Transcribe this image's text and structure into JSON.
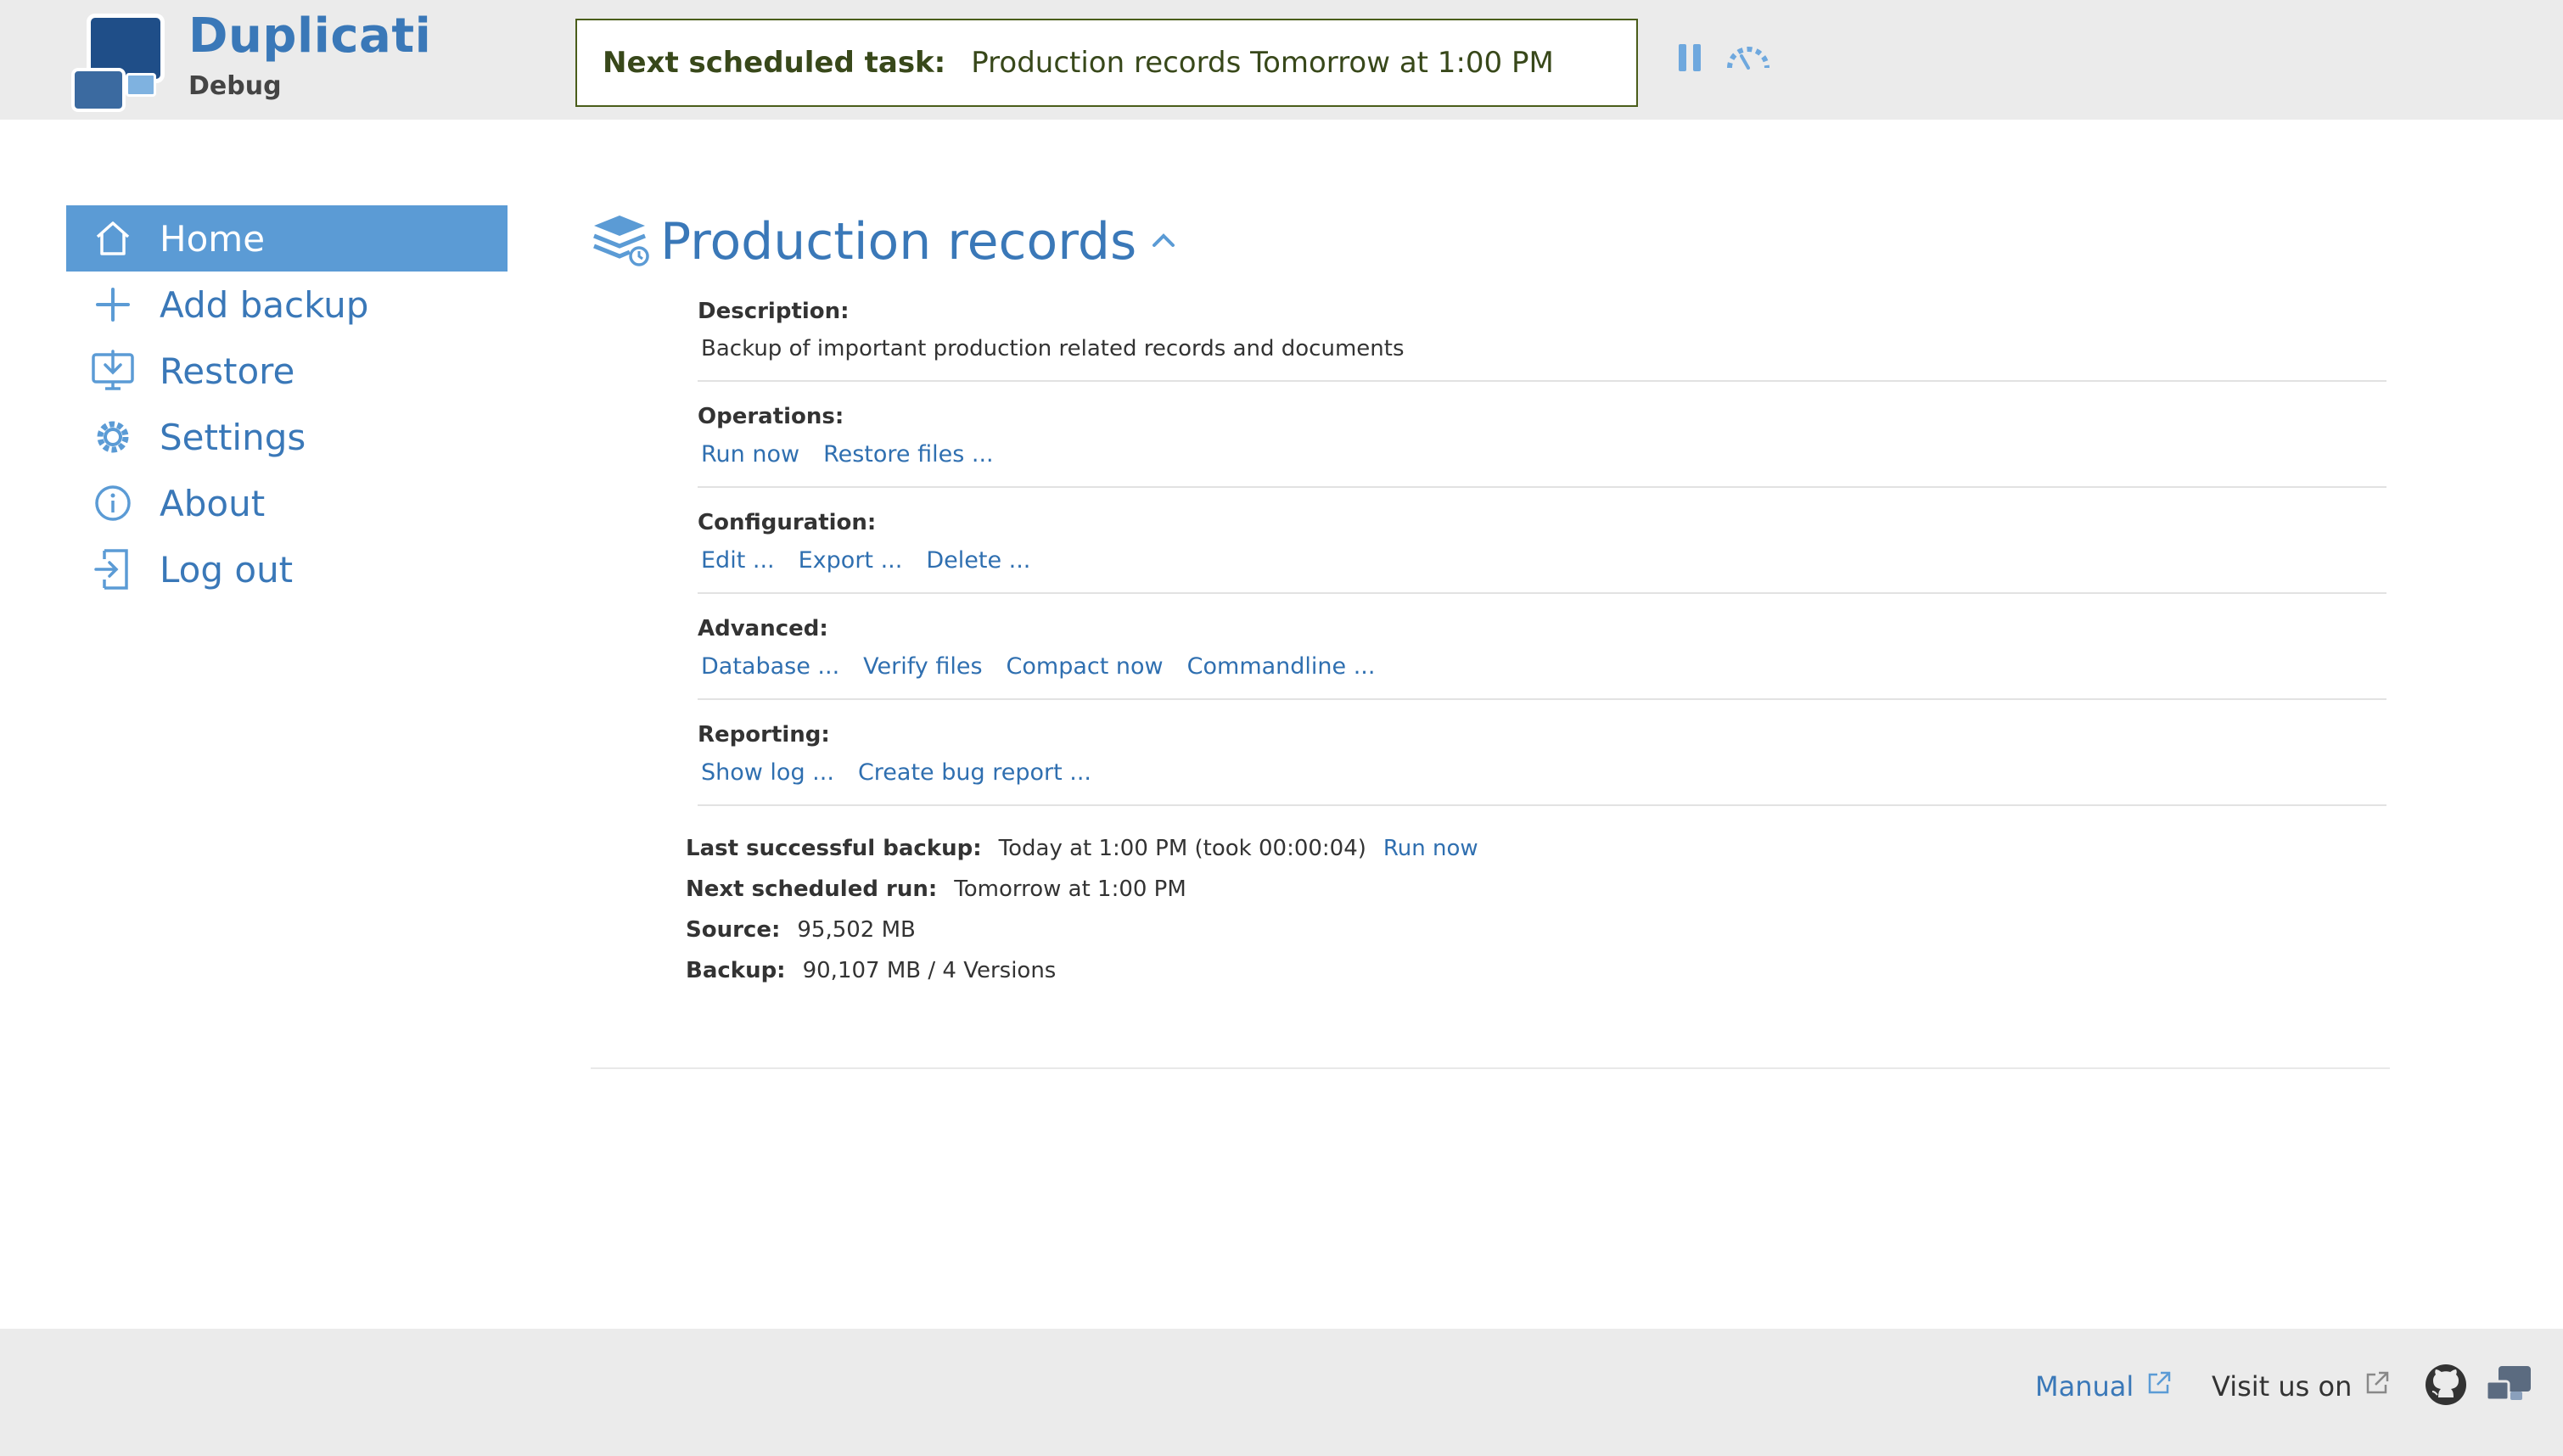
{
  "app": {
    "name": "Duplicati",
    "subtitle": "Debug"
  },
  "header": {
    "task_label": "Next scheduled task:",
    "task_value": "Production records Tomorrow at 1:00 PM",
    "icons": [
      "pause-icon",
      "throttle-icon"
    ]
  },
  "sidebar": {
    "items": [
      {
        "label": "Home",
        "icon": "home-icon",
        "active": true
      },
      {
        "label": "Add backup",
        "icon": "plus-icon",
        "active": false
      },
      {
        "label": "Restore",
        "icon": "restore-icon",
        "active": false
      },
      {
        "label": "Settings",
        "icon": "gear-icon",
        "active": false
      },
      {
        "label": "About",
        "icon": "info-icon",
        "active": false
      },
      {
        "label": "Log out",
        "icon": "logout-icon",
        "active": false
      }
    ]
  },
  "backup": {
    "title": "Production records",
    "description_label": "Description:",
    "description": "Backup of important production related records and documents",
    "operations_label": "Operations:",
    "operations": [
      "Run now",
      "Restore files ..."
    ],
    "configuration_label": "Configuration:",
    "configuration": [
      "Edit ...",
      "Export ...",
      "Delete ..."
    ],
    "advanced_label": "Advanced:",
    "advanced": [
      "Database ...",
      "Verify files",
      "Compact now",
      "Commandline ..."
    ],
    "reporting_label": "Reporting:",
    "reporting": [
      "Show log ...",
      "Create bug report ..."
    ],
    "last_backup_label": "Last successful backup:",
    "last_backup_value": "Today at 1:00 PM (took 00:00:04)",
    "last_backup_run_now": "Run now",
    "next_run_label": "Next scheduled run:",
    "next_run_value": "Tomorrow at 1:00 PM",
    "source_label": "Source:",
    "source_value": "95,502 MB",
    "backup_label": "Backup:",
    "backup_value": "90,107 MB / 4 Versions"
  },
  "footer": {
    "manual": "Manual",
    "visit": "Visit us on"
  },
  "colors": {
    "accent": "#3a78b8",
    "active_nav": "#5b9bd5",
    "header_bg": "#ebebeb",
    "task_border": "#4a5d1a"
  }
}
